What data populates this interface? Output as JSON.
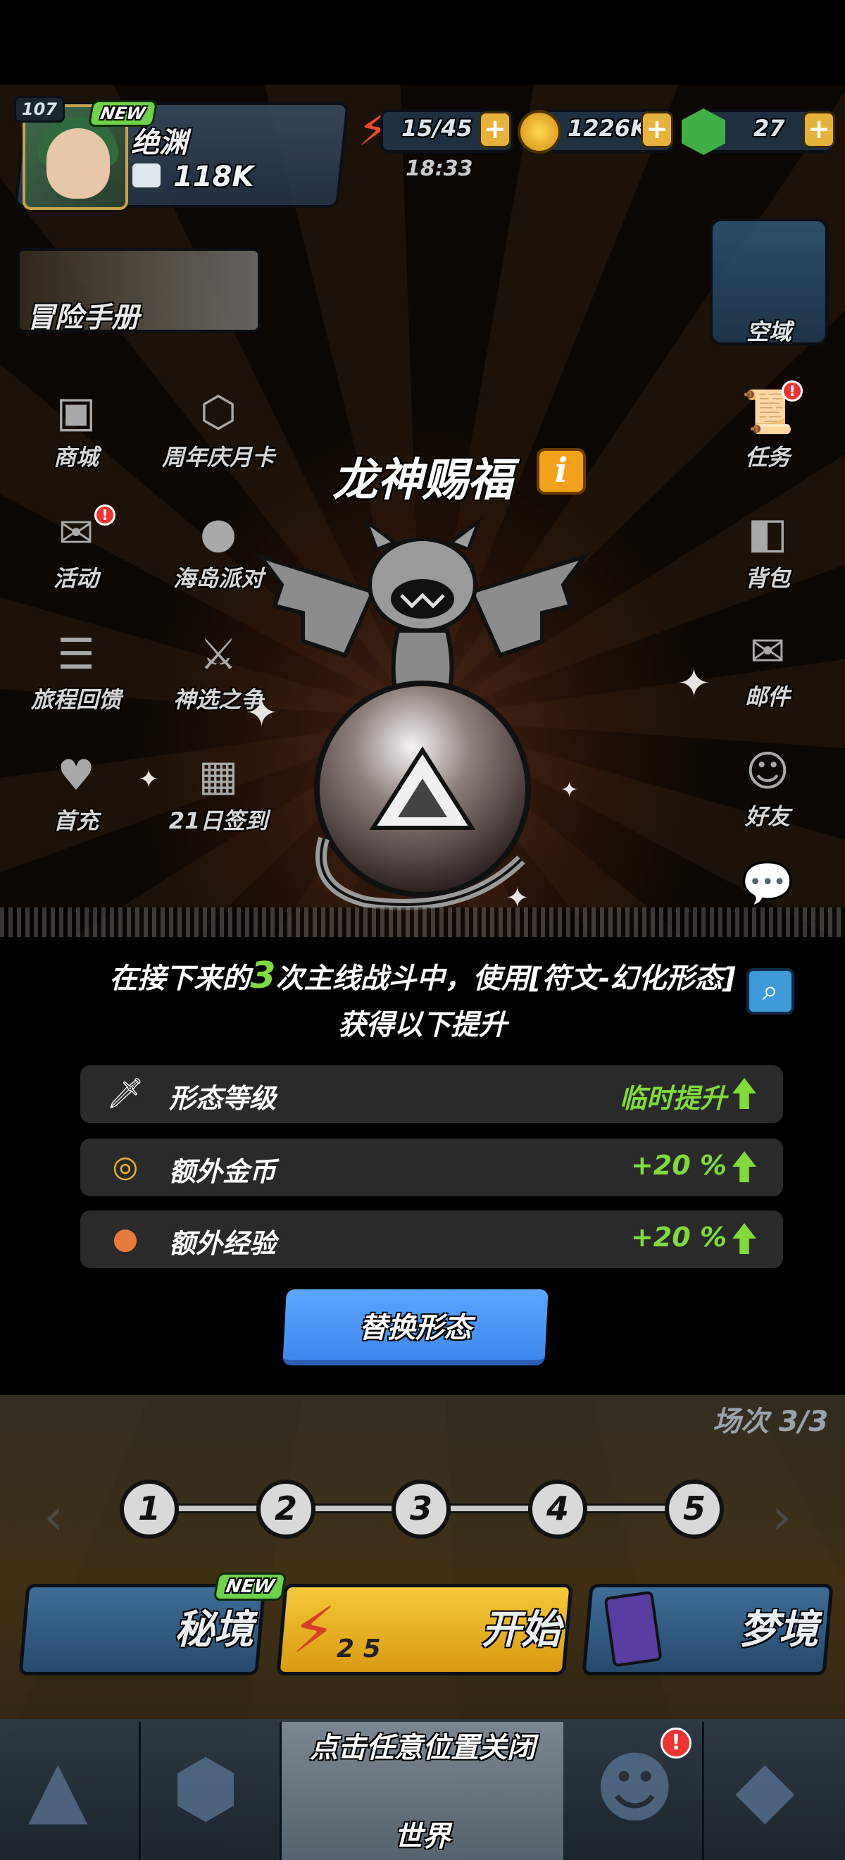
{
  "hud": {
    "level": "107",
    "new_badge": "NEW",
    "player_name": "绝渊",
    "power": "118K",
    "energy": "15/45",
    "energy_timer": "18:33",
    "gold": "1226K",
    "gems": "27",
    "plus": "+"
  },
  "side_left": {
    "adventure": "冒险手册",
    "shop": "商城",
    "anniversary": "周年庆月卡",
    "events": "活动",
    "island": "海岛派对",
    "journey": "旅程回馈",
    "chosen": "神选之争",
    "first_charge": "首充",
    "signin": "21日签到"
  },
  "side_right": {
    "airspace": "空域",
    "tasks": "任务",
    "bag": "背包",
    "mail": "邮件",
    "friends": "好友"
  },
  "dialog": {
    "title": "龙神赐福",
    "info": "i",
    "desc_prefix": "在接下来的",
    "desc_count": "3",
    "desc_suffix": "次主线战斗中，使用[符文-幻化形态]",
    "desc_line2": "获得以下提升",
    "rows": [
      {
        "icon": "sword-icon",
        "label": "形态等级",
        "value": "临时提升"
      },
      {
        "icon": "coins-icon",
        "label": "额外金币",
        "value": "+20 %"
      },
      {
        "icon": "meat-icon",
        "label": "额外经验",
        "value": "+20 %"
      }
    ],
    "swap_button": "替换形态",
    "close_hint": "点击任意位置关闭"
  },
  "stage": {
    "round_text": "场次 3/3",
    "stages": [
      "1",
      "2",
      "3",
      "4",
      "5"
    ]
  },
  "modes": {
    "secret": "秘境",
    "start": "开始",
    "start_cost": "2 5",
    "dream": "梦境",
    "new_badge": "NEW"
  },
  "bottom_nav": {
    "world": "世界",
    "alert": "!"
  },
  "colors": {
    "highlight_green": "#7edb3a",
    "info_orange": "#f2a21a",
    "button_blue": "#4d97f7",
    "row_bg": "#2a2a2a"
  }
}
